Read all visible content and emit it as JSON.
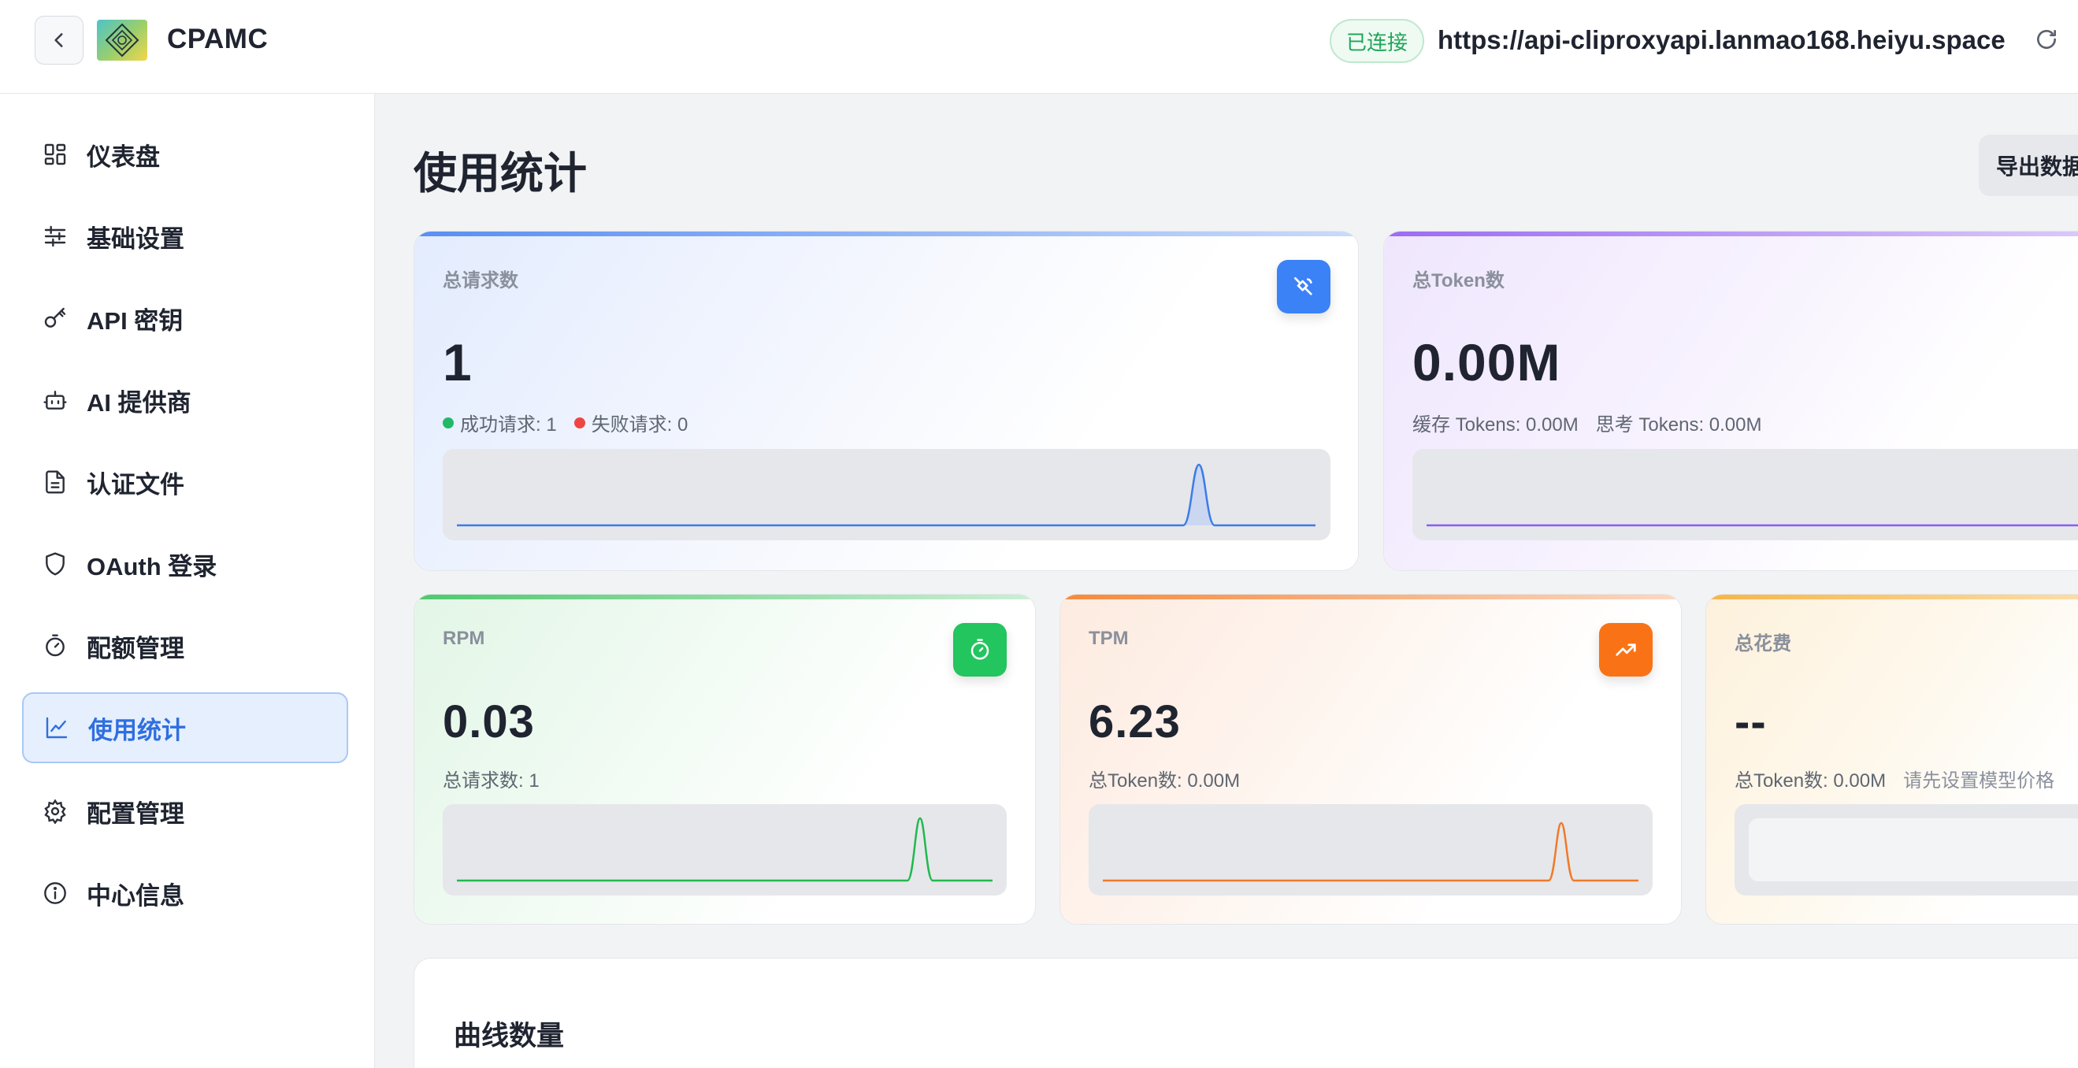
{
  "header": {
    "app_title": "CPAMC",
    "connection_status": "已连接",
    "connection_url": "https://api-cliproxyapi.lanmao168.heiyu.space"
  },
  "sidebar": {
    "items": [
      {
        "label": "仪表盘",
        "icon": "dashboard-icon",
        "active": false
      },
      {
        "label": "基础设置",
        "icon": "sliders-icon",
        "active": false
      },
      {
        "label": "API 密钥",
        "icon": "key-icon",
        "active": false
      },
      {
        "label": "AI 提供商",
        "icon": "bot-icon",
        "active": false
      },
      {
        "label": "认证文件",
        "icon": "file-icon",
        "active": false
      },
      {
        "label": "OAuth 登录",
        "icon": "shield-icon",
        "active": false
      },
      {
        "label": "配额管理",
        "icon": "timer-icon",
        "active": false
      },
      {
        "label": "使用统计",
        "icon": "chart-line-icon",
        "active": true
      },
      {
        "label": "配置管理",
        "icon": "gear-icon",
        "active": false
      },
      {
        "label": "中心信息",
        "icon": "info-icon",
        "active": false
      }
    ]
  },
  "main": {
    "page_title": "使用统计",
    "export_label": "导出数据",
    "cards": {
      "total_requests": {
        "label": "总请求数",
        "value": "1",
        "success_label": "成功请求: 1",
        "fail_label": "失败请求: 0",
        "icon": "satellite-icon",
        "accent": "#3b82f6"
      },
      "total_tokens": {
        "label": "总Token数",
        "value": "0.00M",
        "cached_label": "缓存 Tokens: 0.00M",
        "reasoning_label": "思考 Tokens: 0.00M",
        "accent": "#8b5cf6"
      },
      "rpm": {
        "label": "RPM",
        "value": "0.03",
        "sub": "总请求数: 1",
        "icon": "stopwatch-icon",
        "accent": "#22c55e"
      },
      "tpm": {
        "label": "TPM",
        "value": "6.23",
        "sub": "总Token数: 0.00M",
        "icon": "trending-up-icon",
        "accent": "#f97316"
      },
      "total_cost": {
        "label": "总花费",
        "value": "--",
        "sub": "总Token数: 0.00M",
        "hint": "请先设置模型价格",
        "accent": "#f59e0b"
      }
    },
    "section_title": "曲线数量"
  }
}
